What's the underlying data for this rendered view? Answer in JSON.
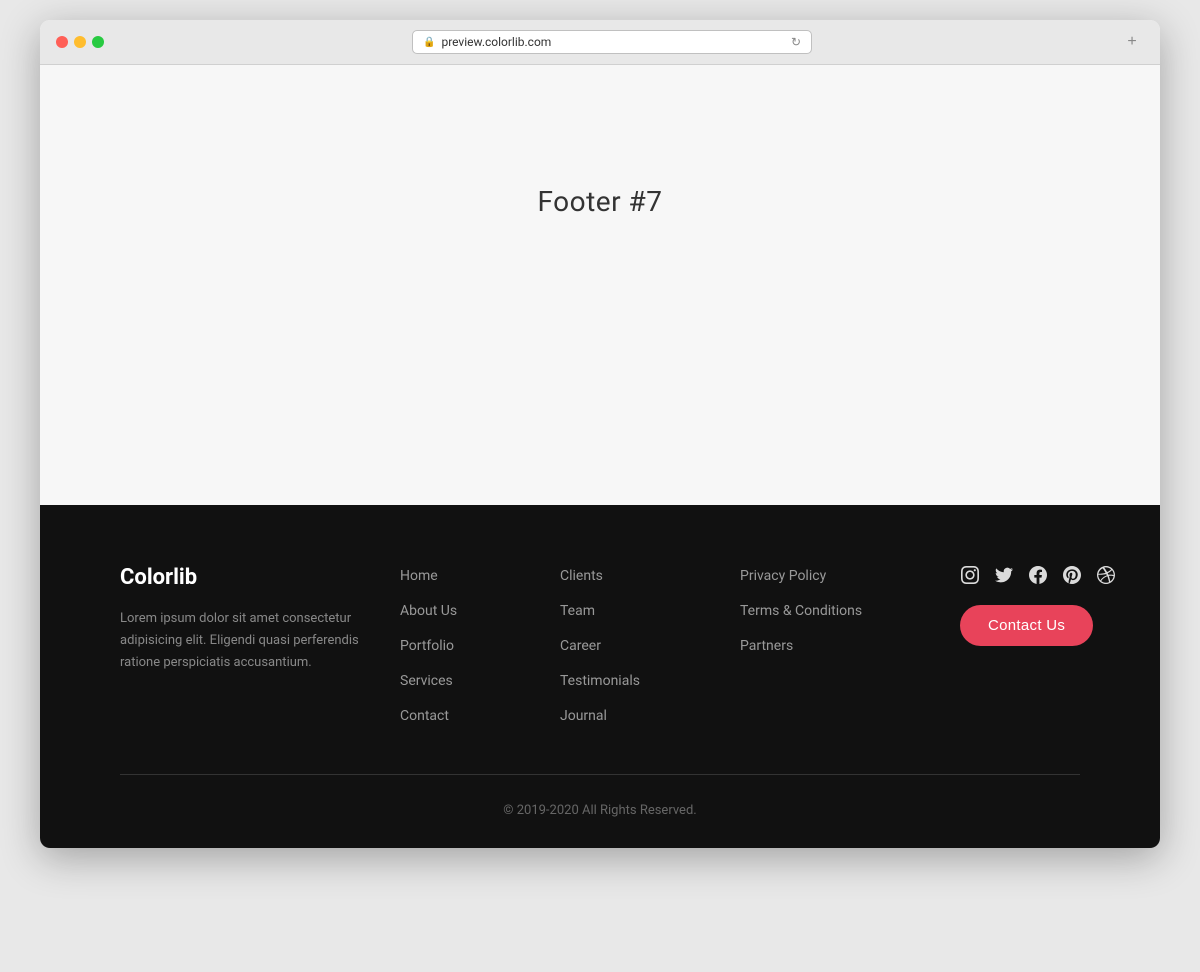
{
  "browser": {
    "url": "preview.colorlib.com",
    "new_tab_icon": "+"
  },
  "page": {
    "title": "Footer #7"
  },
  "footer": {
    "brand": {
      "name": "Colorlib",
      "description": "Lorem ipsum dolor sit amet consectetur adipisicing elit. Eligendi quasi perferendis ratione perspiciatis accusantium."
    },
    "nav_col1": {
      "items": [
        {
          "label": "Home",
          "href": "#"
        },
        {
          "label": "About Us",
          "href": "#"
        },
        {
          "label": "Portfolio",
          "href": "#"
        },
        {
          "label": "Services",
          "href": "#"
        },
        {
          "label": "Contact",
          "href": "#"
        }
      ]
    },
    "nav_col2": {
      "items": [
        {
          "label": "Clients",
          "href": "#"
        },
        {
          "label": "Team",
          "href": "#"
        },
        {
          "label": "Career",
          "href": "#"
        },
        {
          "label": "Testimonials",
          "href": "#"
        },
        {
          "label": "Journal",
          "href": "#"
        }
      ]
    },
    "nav_col3": {
      "items": [
        {
          "label": "Privacy Policy",
          "href": "#"
        },
        {
          "label": "Terms & Conditions",
          "href": "#"
        },
        {
          "label": "Partners",
          "href": "#"
        }
      ]
    },
    "contact_button": "Contact Us",
    "social_icons": [
      "instagram",
      "twitter",
      "facebook",
      "pinterest",
      "dribbble"
    ],
    "copyright": "© 2019-2020 All Rights Reserved."
  }
}
